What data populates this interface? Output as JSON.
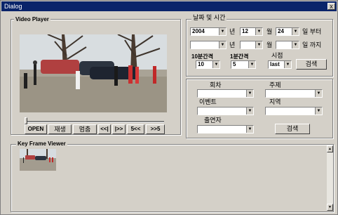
{
  "window": {
    "title": "Dialog",
    "close_label": "x"
  },
  "video_player": {
    "title": "Video Player",
    "buttons": [
      "OPEN",
      "재생",
      "멈춤",
      "<<|",
      "|>>",
      "5<<",
      ">>5"
    ]
  },
  "date_time": {
    "title": "날짜 및 시간",
    "from": {
      "year": "2004",
      "year_unit": "년",
      "month": "12",
      "month_unit": "월",
      "day": "24",
      "day_unit": "일 부터"
    },
    "to": {
      "year": "",
      "year_unit": "년",
      "month": "",
      "month_unit": "월",
      "day": "",
      "day_unit": "일 까지"
    },
    "interval10_label": "10분간격",
    "interval1_label": "1분간격",
    "time_label": "시점",
    "interval10_value": "10",
    "interval1_value": "5",
    "time_value": "last",
    "search_label": "검색"
  },
  "filters": {
    "round_label": "회차",
    "subject_label": "주제",
    "event_label": "이벤트",
    "region_label": "지역",
    "performer_label": "출연자",
    "search_label": "검색"
  },
  "key_frame_viewer": {
    "title": "Key Frame Viewer"
  },
  "icons": {
    "dropdown": "chevron-down-icon",
    "scroll_up": "scroll-up-icon",
    "scroll_down": "scroll-down-icon"
  }
}
